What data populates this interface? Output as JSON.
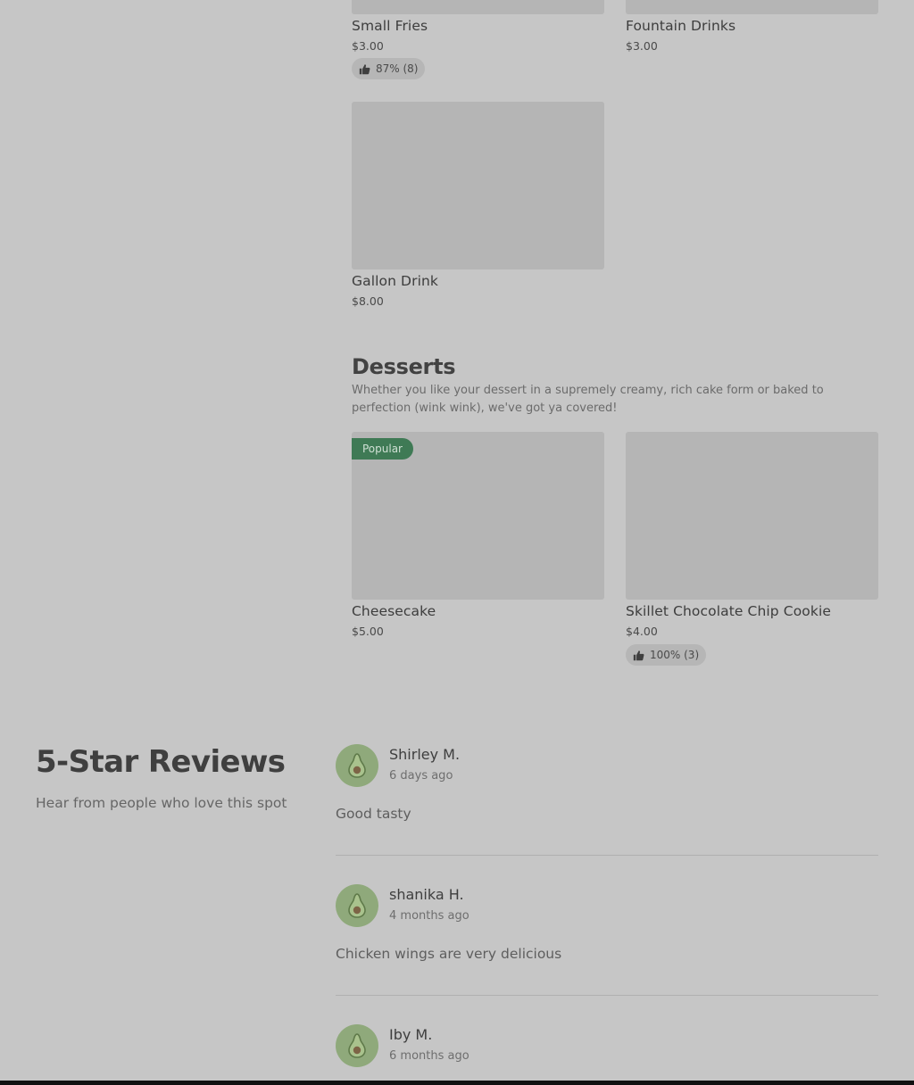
{
  "drinks_items": [
    {
      "name": "Small Fries",
      "price": "$3.00",
      "rating": "87% (8)"
    },
    {
      "name": "Fountain Drinks",
      "price": "$3.00"
    },
    {
      "name": "Gallon Drink",
      "price": "$8.00"
    }
  ],
  "desserts": {
    "title": "Desserts",
    "description": "Whether you like your dessert in a supremely creamy, rich cake form or baked to perfection (wink wink), we've got ya covered!",
    "items": [
      {
        "name": "Cheesecake",
        "price": "$5.00",
        "badge": "Popular"
      },
      {
        "name": "Skillet Chocolate Chip Cookie",
        "price": "$4.00",
        "rating": "100% (3)"
      }
    ]
  },
  "reviews": {
    "title": "5-Star Reviews",
    "subtitle": "Hear from people who love this spot",
    "list": [
      {
        "name": "Shirley M.",
        "time": "6 days ago",
        "text": "Good tasty",
        "avatar_icon": "avocado-icon"
      },
      {
        "name": "shanika H.",
        "time": "4 months ago",
        "text": "Chicken wings are very delicious",
        "avatar_icon": "avocado-icon"
      },
      {
        "name": "Iby M.",
        "time": "6 months ago",
        "text": "",
        "avatar_icon": "avocado-icon"
      }
    ]
  },
  "colors": {
    "background": "#c6c6c6",
    "popular_badge": "#3f7a55",
    "avatar": "#8fa97b"
  }
}
